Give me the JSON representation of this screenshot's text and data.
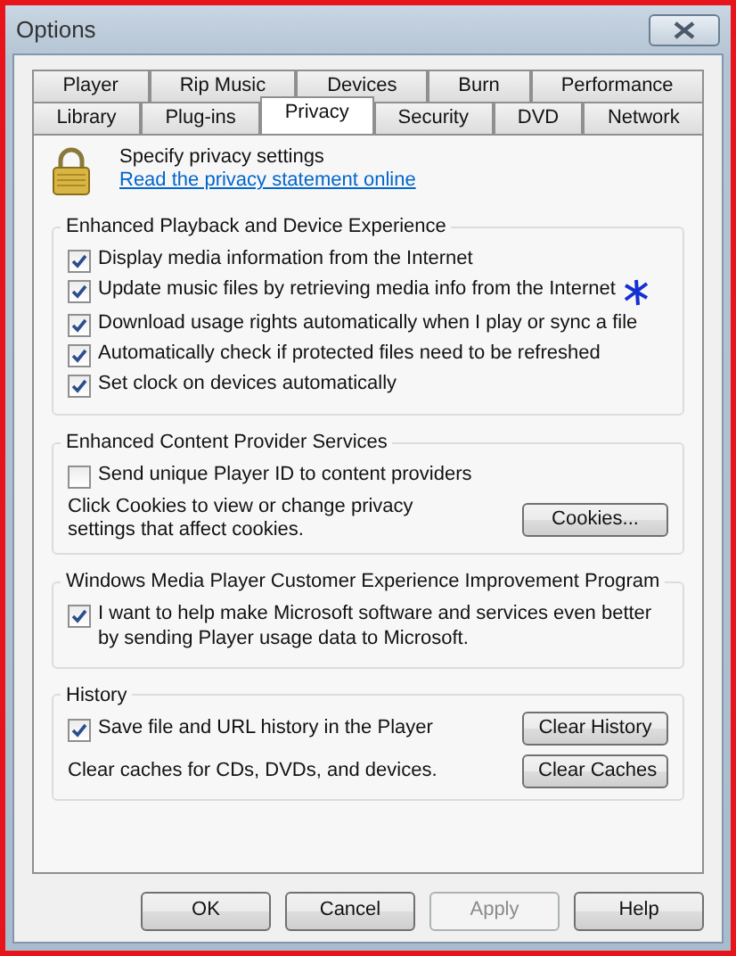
{
  "window": {
    "title": "Options"
  },
  "tab_rows": [
    [
      {
        "label": "Player",
        "selected": false
      },
      {
        "label": "Rip Music",
        "selected": false
      },
      {
        "label": "Devices",
        "selected": false
      },
      {
        "label": "Burn",
        "selected": false
      },
      {
        "label": "Performance",
        "selected": false
      }
    ],
    [
      {
        "label": "Library",
        "selected": false
      },
      {
        "label": "Plug-ins",
        "selected": false
      },
      {
        "label": "Privacy",
        "selected": true
      },
      {
        "label": "Security",
        "selected": false
      },
      {
        "label": "DVD",
        "selected": false
      },
      {
        "label": "Network",
        "selected": false
      }
    ]
  ],
  "header": {
    "title": "Specify privacy settings",
    "link": "Read the privacy statement online"
  },
  "sections": [
    {
      "title": "Enhanced Playback and Device Experience",
      "items": [
        {
          "kind": "checkbox",
          "label": "Display media information from the Internet",
          "checked": true,
          "annotated": false
        },
        {
          "kind": "checkbox",
          "label": "Update music files by retrieving media info from the Internet",
          "checked": true,
          "annotated": true
        },
        {
          "kind": "checkbox",
          "label": "Download usage rights automatically when I play or sync a file",
          "checked": true,
          "annotated": false
        },
        {
          "kind": "checkbox",
          "label": "Automatically check if protected files need to be refreshed",
          "checked": true,
          "annotated": false
        },
        {
          "kind": "checkbox",
          "label": "Set clock on devices automatically",
          "checked": true,
          "annotated": false
        }
      ]
    },
    {
      "title": "Enhanced Content Provider Services",
      "items": [
        {
          "kind": "checkbox",
          "label": "Send unique Player ID to content providers",
          "checked": false,
          "annotated": false
        },
        {
          "kind": "text_button",
          "text": "Click Cookies to view or change privacy settings that affect cookies.",
          "button": "Cookies..."
        }
      ]
    },
    {
      "title": "Windows Media Player Customer Experience Improvement Program",
      "items": [
        {
          "kind": "checkbox",
          "label": "I want to help make Microsoft software and services even better by sending Player usage data to Microsoft.",
          "checked": true,
          "annotated": false
        }
      ]
    },
    {
      "title": "History",
      "items": [
        {
          "kind": "checkbox_button",
          "label": "Save file and URL history in the Player",
          "checked": true,
          "button": "Clear History"
        },
        {
          "kind": "text_button",
          "text": "Clear caches for CDs, DVDs, and devices.",
          "button": "Clear Caches"
        }
      ]
    }
  ],
  "buttons": [
    {
      "label": "OK",
      "disabled": false
    },
    {
      "label": "Cancel",
      "disabled": false
    },
    {
      "label": "Apply",
      "disabled": true
    },
    {
      "label": "Help",
      "disabled": false
    }
  ]
}
